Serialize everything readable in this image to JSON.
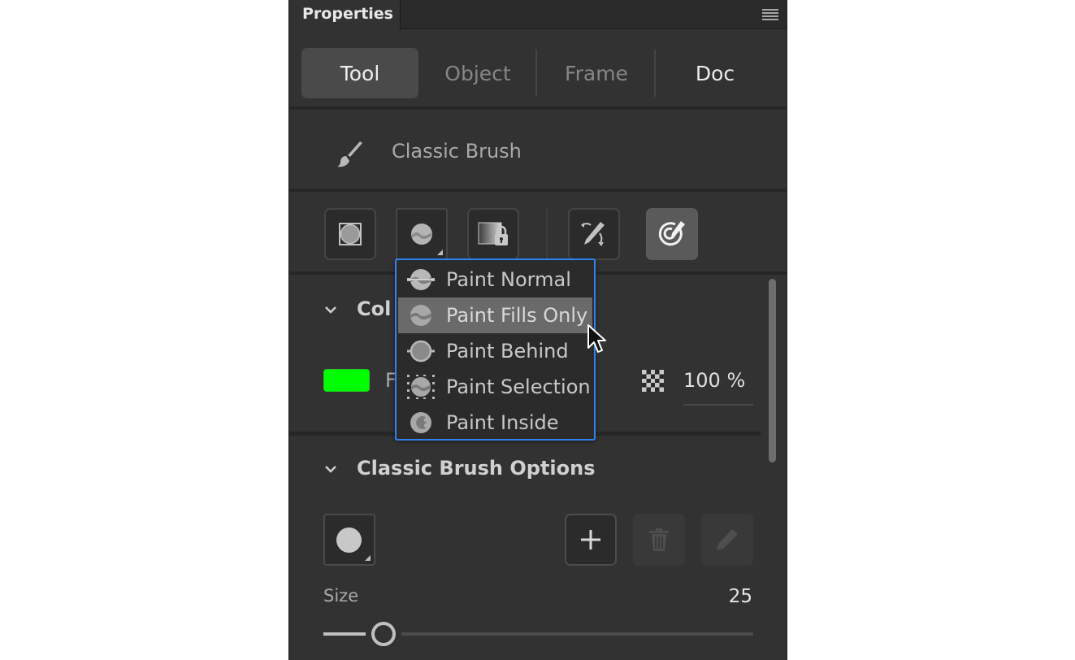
{
  "header": {
    "title": "Properties",
    "menu_icon": "hamburger-menu-icon"
  },
  "tabs": [
    {
      "label": "Tool",
      "active": true
    },
    {
      "label": "Object",
      "active": false
    },
    {
      "label": "Frame",
      "active": false
    },
    {
      "label": "Doc",
      "active": false
    }
  ],
  "tool": {
    "name": "Classic Brush",
    "icon": "brush-icon"
  },
  "tool_options": [
    {
      "name": "object-drawing-mode",
      "icon": "object-drawing-icon",
      "active": false
    },
    {
      "name": "brush-mode",
      "icon": "paint-fills-only-icon",
      "active": false,
      "has_submenu": true
    },
    {
      "name": "lock-fill",
      "icon": "lock-fill-icon",
      "active": false
    },
    {
      "name": "brush-rotate",
      "icon": "pencil-rotate-icon",
      "active": false
    },
    {
      "name": "pressure",
      "icon": "pressure-target-icon",
      "active": true
    }
  ],
  "brush_mode_menu": {
    "items": [
      {
        "label": "Paint Normal",
        "icon": "paint-normal-icon"
      },
      {
        "label": "Paint Fills Only",
        "icon": "paint-fills-only-icon",
        "hovered": true
      },
      {
        "label": "Paint Behind",
        "icon": "paint-behind-icon"
      },
      {
        "label": "Paint Selection",
        "icon": "paint-selection-icon"
      },
      {
        "label": "Paint Inside",
        "icon": "paint-inside-icon"
      }
    ]
  },
  "color_section": {
    "title": "Col",
    "fill_label": "F",
    "fill_color": "#00ff00",
    "alpha_value": "100 %"
  },
  "brush_options": {
    "title": "Classic Brush Options",
    "buttons": [
      "add-brush",
      "delete-brush",
      "edit-brush"
    ],
    "size_label": "Size",
    "size_value": "25",
    "size_slider_fraction": 0.14
  },
  "colors": {
    "panel_bg": "#323232",
    "accent": "#2f84f3",
    "active_tab": "#4a4a4a",
    "hover_item": "#6a6a6a"
  }
}
